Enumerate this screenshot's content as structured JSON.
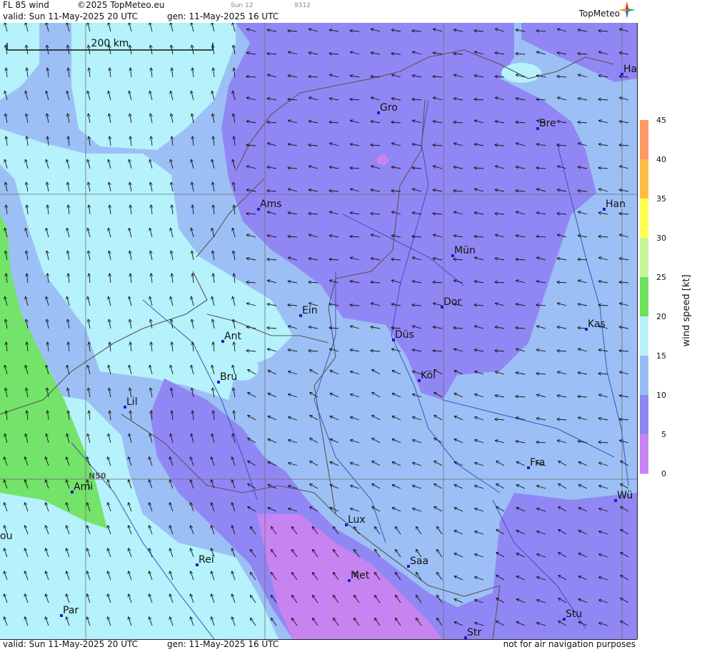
{
  "header": {
    "product": "FL 85 wind",
    "copyright": "©2025 TopMeteo.eu",
    "run_tag": "Sun 12",
    "code": "9312",
    "valid": "valid:  Sun  11-May-2025  20 UTC",
    "gen": "gen: 11-May-2025 16 UTC",
    "brand": "TopMeteo"
  },
  "footer": {
    "valid": "valid:  Sun  11-May-2025  20 UTC",
    "gen": "gen: 11-May-2025 16 UTC",
    "disclaimer": "not for air navigation purposes"
  },
  "scale_bar": {
    "label": "200 km"
  },
  "latitude_label": "N50",
  "cities": [
    {
      "name": "Gro"
    },
    {
      "name": "Bre"
    },
    {
      "name": "Ha"
    },
    {
      "name": "Ams"
    },
    {
      "name": "Han"
    },
    {
      "name": "Mün"
    },
    {
      "name": "Dor"
    },
    {
      "name": "Ein"
    },
    {
      "name": "Kas"
    },
    {
      "name": "Ant"
    },
    {
      "name": "Düs"
    },
    {
      "name": "Bru"
    },
    {
      "name": "Köl"
    },
    {
      "name": "Lil"
    },
    {
      "name": "Fra"
    },
    {
      "name": "Ami"
    },
    {
      "name": "Wü"
    },
    {
      "name": "Lux"
    },
    {
      "name": "Rei"
    },
    {
      "name": "Saa"
    },
    {
      "name": "Met"
    },
    {
      "name": "Par"
    },
    {
      "name": "Stu"
    },
    {
      "name": "Str"
    },
    {
      "name": "ou"
    }
  ],
  "colorbar": {
    "label": "wind  speed  [kt]",
    "ticks": [
      "0",
      "5",
      "10",
      "15",
      "20",
      "25",
      "30",
      "35",
      "40",
      "45"
    ],
    "colors": [
      "#c784f0",
      "#8f86f2",
      "#99bdf2",
      "#b8f2f8",
      "#6fe05e",
      "#c8f59a",
      "#ffff55",
      "#ffbb44",
      "#ff9966",
      "#ff7755"
    ]
  },
  "colors": {
    "calm": "#c784f0",
    "light": "#9187f4",
    "moderate": "#9cc0f5",
    "fresh": "#b5f2fb",
    "strong": "#74e36a",
    "grid": "#6b6b6b",
    "border": "#555555",
    "river": "#3355bb",
    "city": "#1b1bd6"
  },
  "icons": [
    "compass-star-icon",
    "wind-arrow-icon",
    "city-marker-icon"
  ]
}
